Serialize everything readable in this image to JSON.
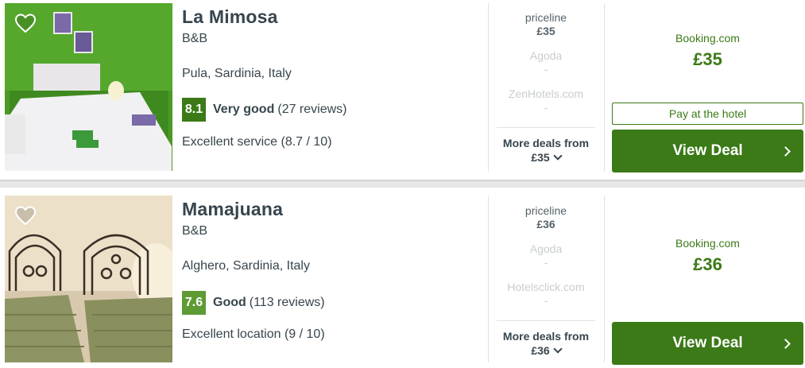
{
  "hotels": [
    {
      "name": "La Mimosa",
      "type": "B&B",
      "location": "Pula, Sardinia, Italy",
      "score": "8.1",
      "rating_label": "Very good",
      "reviews": "(27 reviews)",
      "subscore": "Excellent service (8.7 / 10)",
      "providers": [
        {
          "name": "priceline",
          "price": "£35"
        },
        {
          "name": "Agoda",
          "price": "-"
        },
        {
          "name": "ZenHotels.com",
          "price": "-"
        }
      ],
      "more_deals_label": "More deals from",
      "more_deals_price": "£35",
      "best_provider": "Booking.com",
      "best_price": "£35",
      "pay_at_hotel": "Pay at the hotel",
      "deal_label": "View Deal"
    },
    {
      "name": "Mamajuana",
      "type": "B&B",
      "location": "Alghero, Sardinia, Italy",
      "score": "7.6",
      "rating_label": "Good",
      "reviews": "(113 reviews)",
      "subscore": "Excellent location (9 / 10)",
      "providers": [
        {
          "name": "priceline",
          "price": "£36"
        },
        {
          "name": "Agoda",
          "price": "-"
        },
        {
          "name": "Hotelsclick.com",
          "price": "-"
        }
      ],
      "more_deals_label": "More deals from",
      "more_deals_price": "£36",
      "best_provider": "Booking.com",
      "best_price": "£36",
      "deal_label": "View Deal"
    }
  ],
  "colors": {
    "accent_green": "#3b7a17",
    "score_dark": "#3b7a17",
    "score_mid": "#5e9b34",
    "text": "#37454d",
    "muted": "#c8cdd0"
  },
  "icons": {
    "favorite": "heart-icon",
    "expand": "chevron-down-icon",
    "go": "chevron-right-icon"
  }
}
